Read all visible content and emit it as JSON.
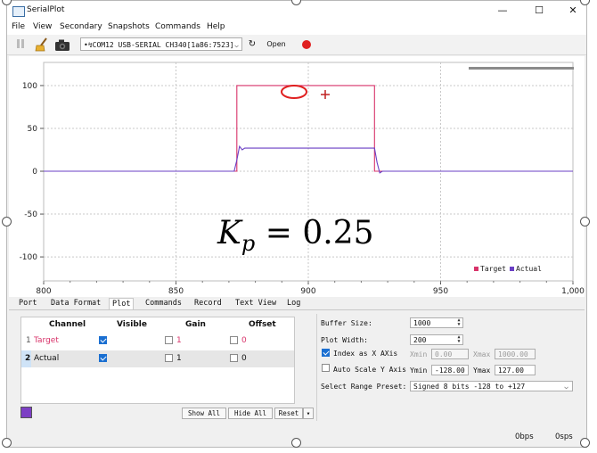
{
  "window": {
    "title": "SerialPlot",
    "controls": {
      "minimize": "—",
      "maximize": "☐",
      "close": "✕"
    }
  },
  "menu": [
    "File",
    "View",
    "Secondary",
    "Snapshots",
    "Commands",
    "Help"
  ],
  "toolbar": {
    "port": "•↯COM12 USB-SERIAL CH340[1a86:7523]",
    "refresh_icon": "refresh-icon",
    "open_label": "Open",
    "record_color": "#e02020"
  },
  "annotation": {
    "kp_label": "= 0.25"
  },
  "chart_data": {
    "type": "line",
    "xlabel": "",
    "ylabel": "",
    "xlim": [
      800,
      1000
    ],
    "ylim": [
      -128,
      127
    ],
    "x_ticks": [
      "800",
      "850",
      "900",
      "950",
      "1,000"
    ],
    "y_ticks": [
      "100",
      "50",
      "0",
      "-50",
      "-100"
    ],
    "grid": true,
    "legend_position": "bottom-right",
    "series": [
      {
        "name": "Target",
        "color": "#d8336a",
        "points": [
          [
            800,
            0
          ],
          [
            873,
            0
          ],
          [
            873,
            100
          ],
          [
            925,
            100
          ],
          [
            925,
            0
          ],
          [
            1000,
            0
          ]
        ]
      },
      {
        "name": "Actual",
        "color": "#6a3fc4",
        "points": [
          [
            800,
            0
          ],
          [
            872,
            0
          ],
          [
            873,
            13
          ],
          [
            874,
            29
          ],
          [
            875,
            25
          ],
          [
            876,
            27
          ],
          [
            925,
            27
          ],
          [
            926,
            10
          ],
          [
            927,
            -2
          ],
          [
            928,
            0
          ],
          [
            1000,
            0
          ]
        ]
      }
    ]
  },
  "tabs": [
    {
      "label": "Port",
      "active": false
    },
    {
      "label": "Data Format",
      "active": false
    },
    {
      "label": "Plot",
      "active": true
    },
    {
      "label": "Commands",
      "active": false
    },
    {
      "label": "Record",
      "active": false
    },
    {
      "label": "Text View",
      "active": false
    },
    {
      "label": "Log",
      "active": false
    }
  ],
  "channels": {
    "headers": {
      "channel": "Channel",
      "visible": "Visible",
      "gain": "Gain",
      "offset": "Offset"
    },
    "rows": [
      {
        "index": "1",
        "name": "Target",
        "visible": true,
        "gain_checked": false,
        "gain": "1",
        "offset_checked": false,
        "offset": "0"
      },
      {
        "index": "2",
        "name": "Actual",
        "visible": true,
        "gain_checked": false,
        "gain": "1",
        "offset_checked": false,
        "offset": "0"
      }
    ],
    "buttons": {
      "show_all": "Show All",
      "hide_all": "Hide All",
      "reset": "Reset",
      "reset_menu": "▾"
    },
    "selected_color": "#7c3fc4"
  },
  "plot_settings": {
    "buffer_size_label": "Buffer Size:",
    "buffer_size": "1000",
    "plot_width_label": "Plot Width:",
    "plot_width": "200",
    "index_as_x_label": "Index as X AXis",
    "index_as_x": true,
    "xmin_label": "Xmin",
    "xmin": "0.00",
    "xmax_label": "Xmax",
    "xmax": "1000.00",
    "auto_scale_label": "Auto Scale Y Axis",
    "auto_scale": false,
    "ymin_label": "Ymin",
    "ymin": "-128.00",
    "ymax_label": "Ymax",
    "ymax": "127.00",
    "range_preset_label": "Select Range Preset:",
    "range_preset": "Signed 8 bits -128 to +127"
  },
  "status": {
    "bps": "0bps",
    "sps": "0sps"
  }
}
